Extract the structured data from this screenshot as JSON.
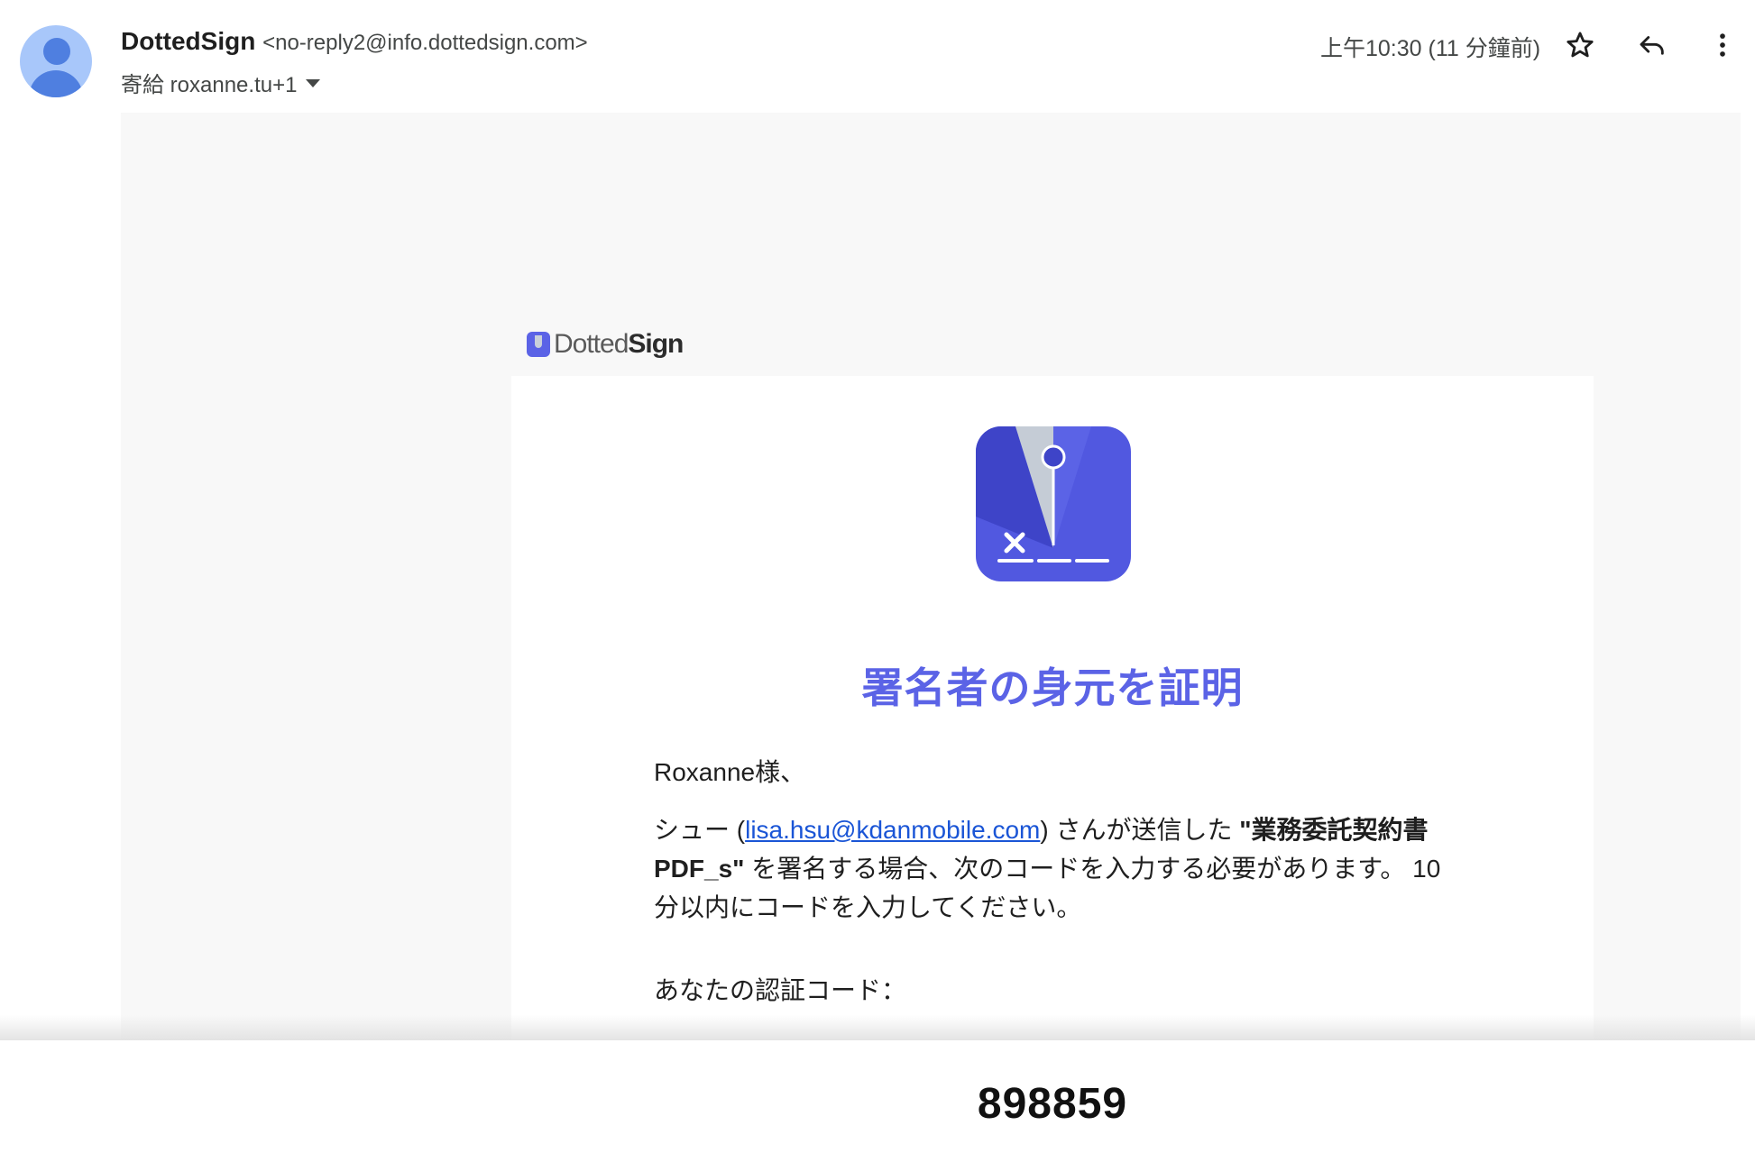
{
  "header": {
    "sender_name": "DottedSign",
    "sender_email": "<no-reply2@info.dottedsign.com>",
    "to_text": "寄給 roxanne.tu+1",
    "time": "上午10:30 (11 分鐘前)"
  },
  "icons": {
    "avatar": "person-avatar-icon",
    "star": "star-icon",
    "reply": "reply-icon",
    "more": "more-vert-icon",
    "dropdown": "chevron-down-icon"
  },
  "email": {
    "brand_light": "Dotted",
    "brand_bold": "Sign",
    "title": "署名者の身元を証明",
    "greeting": "Roxanne様、",
    "para_before": "シュー (",
    "para_link": "lisa.hsu@kdanmobile.com",
    "para_after_link": ") さんが送信した ",
    "para_doc": "\"業務委託契約書PDF_s\"",
    "para_after_doc": " を署名する場合、次のコードを入力する必要があります。 10分以内にコードを入力してください。",
    "code_label": "あなたの認証コード：",
    "code": "898859"
  },
  "colors": {
    "brand": "#5b63e6",
    "avatar_bg": "#a8c7fa",
    "link": "#1a55d6"
  }
}
